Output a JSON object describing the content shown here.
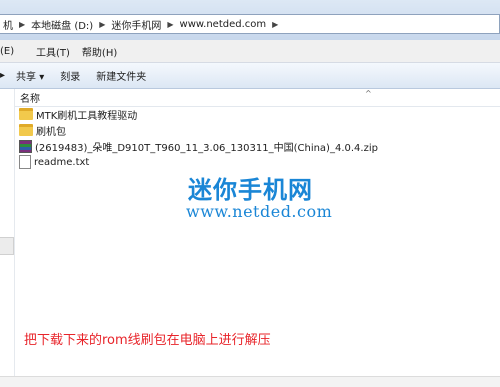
{
  "address_bar": {
    "crumbs": [
      "机",
      "本地磁盘 (D:)",
      "迷你手机网",
      "www.netded.com"
    ],
    "separator": "▶"
  },
  "menubar": {
    "items": [
      "(E)",
      "工具(T)",
      "帮助(H)"
    ]
  },
  "toolbar": {
    "share": "共享 ▾",
    "burn": "刻录",
    "new_folder": "新建文件夹"
  },
  "column_header": {
    "name": "名称",
    "sort_caret": "^"
  },
  "files": [
    {
      "name": "MTK刷机工具教程驱动",
      "icon": "folder-icon"
    },
    {
      "name": "刷机包",
      "icon": "folder-icon"
    },
    {
      "name": "(2619483)_朵唯_D910T_T960_11_3.06_130311_中国(China)_4.0.4.zip",
      "icon": "zip-archive-icon"
    },
    {
      "name": "readme.txt",
      "icon": "text-file-icon"
    }
  ],
  "watermark": {
    "brand": "迷你手机网",
    "url": "www.netded.com"
  },
  "annotation": "把下载下来的rom线刷包在电脑上进行解压",
  "colors": {
    "watermark": "#1a86d6",
    "annotation": "#e8242a",
    "folder": "#f2c94c"
  }
}
